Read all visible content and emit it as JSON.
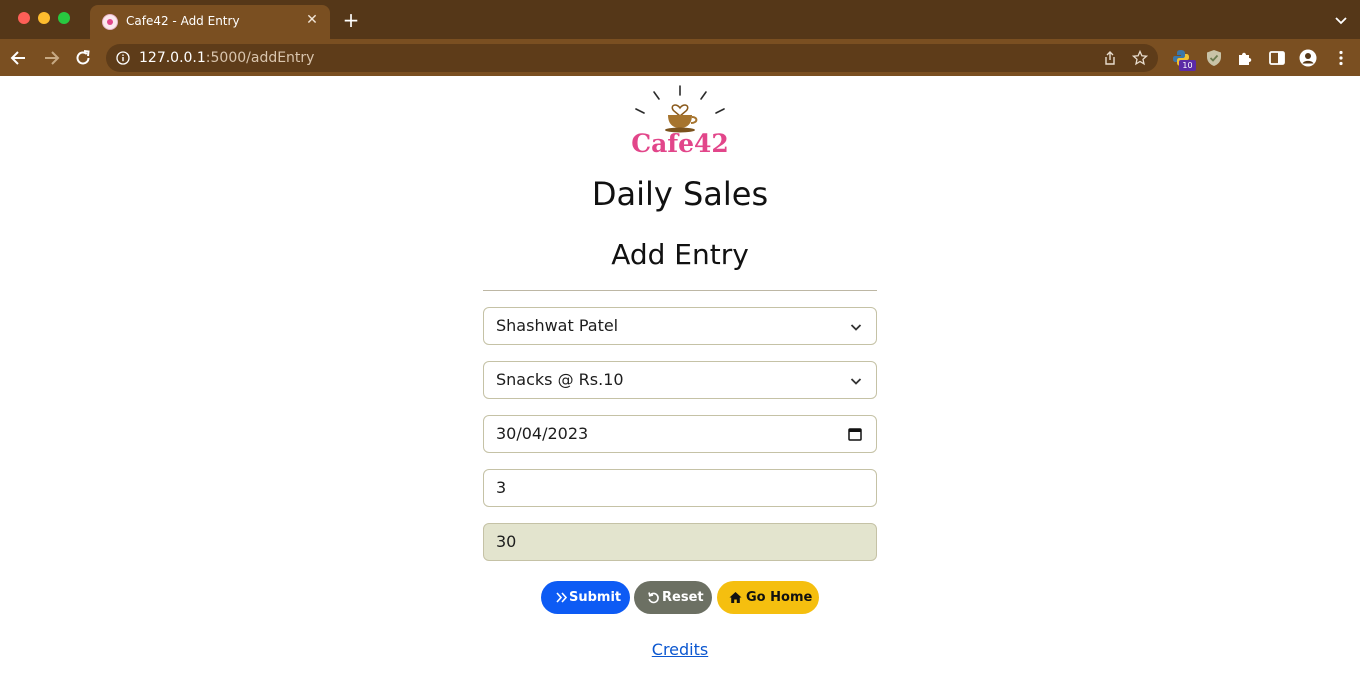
{
  "browser": {
    "tab_title": "Cafe42 - Add Entry",
    "url_host": "127.0.0.1",
    "url_path": ":5000/addEntry",
    "extension_badge": "10"
  },
  "header": {
    "logo_text": "Cafe42",
    "title": "Daily Sales",
    "subtitle": "Add Entry"
  },
  "form": {
    "name_select": "Shashwat Patel",
    "item_select": "Snacks @ Rs.10",
    "date": "30/04/2023",
    "quantity": "3",
    "total": "30"
  },
  "buttons": {
    "submit": "Submit",
    "reset": "Reset",
    "home": "Go Home"
  },
  "footer": {
    "credits": "Credits"
  },
  "colors": {
    "tab_strip": "#553718",
    "toolbar": "#7a4f21",
    "submit": "#0d5bf4",
    "reset": "#6c7063",
    "home": "#f5bf0f",
    "logo_text": "#e2468a"
  }
}
